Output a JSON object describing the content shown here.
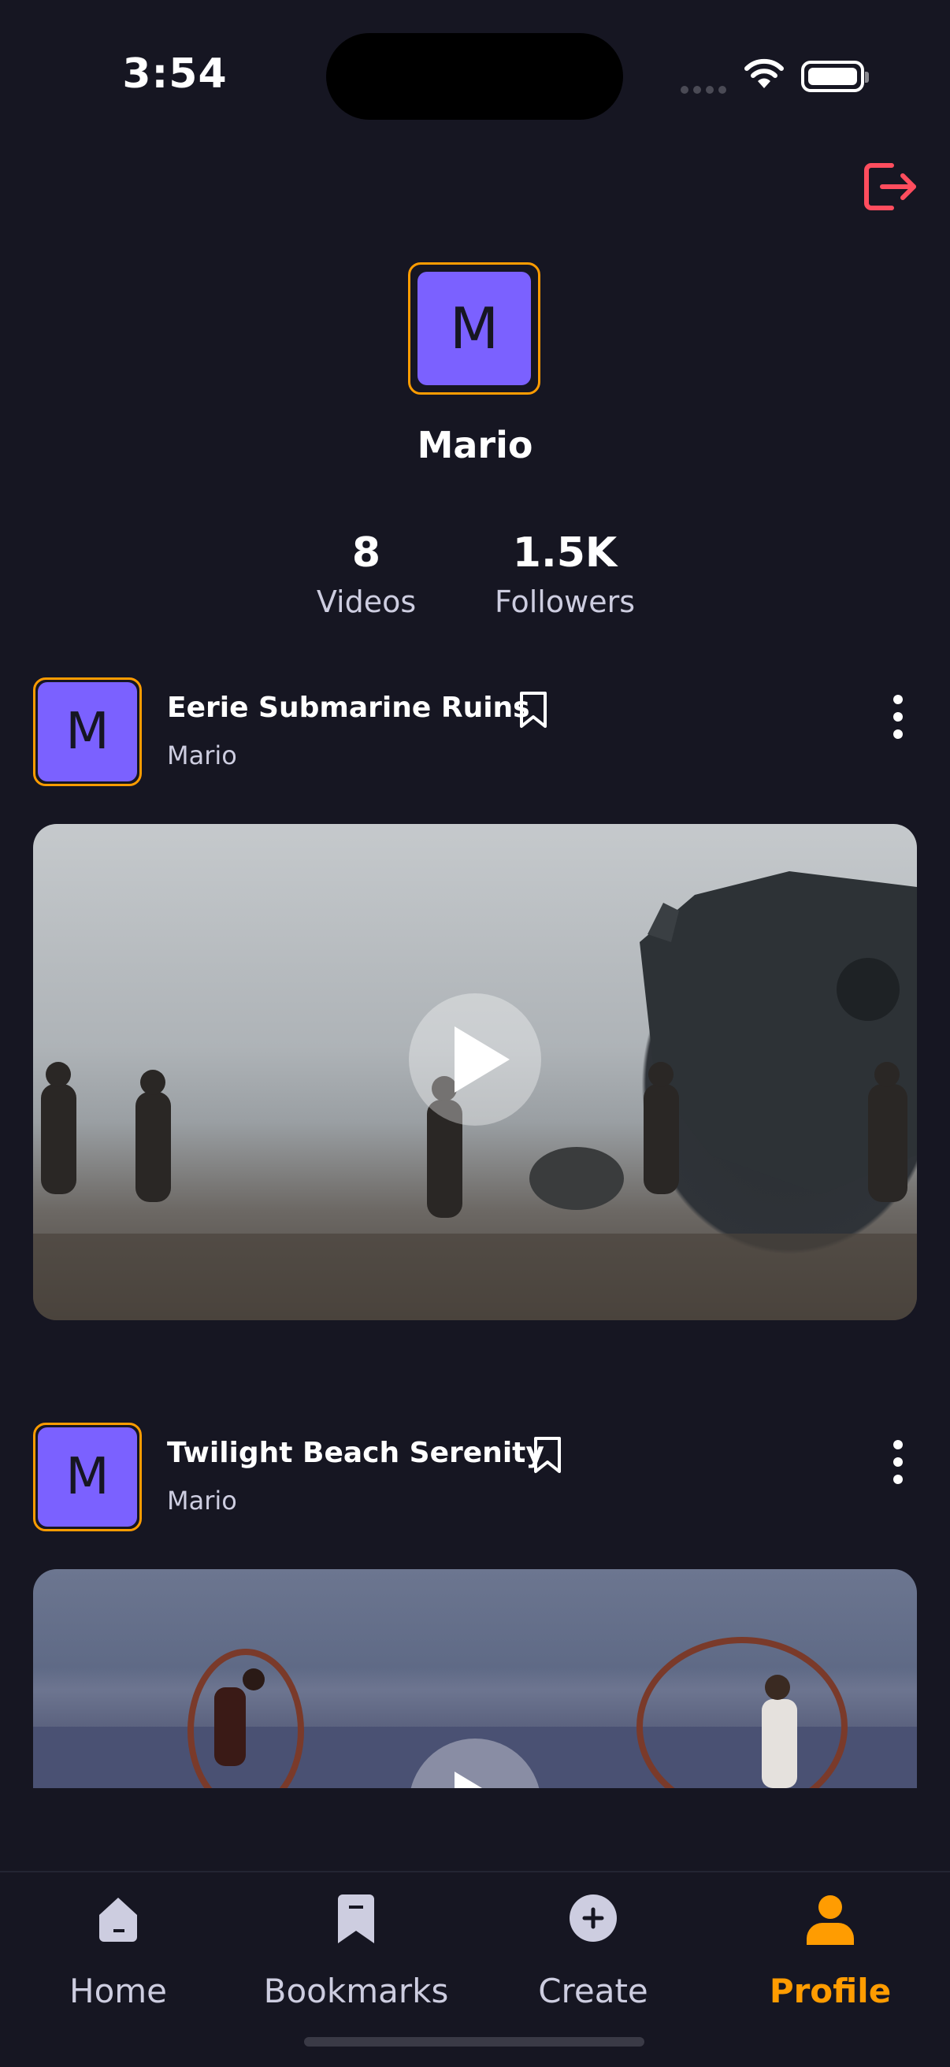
{
  "status_bar": {
    "time": "3:54"
  },
  "profile": {
    "avatar_letter": "M",
    "name": "Mario",
    "stats": [
      {
        "value": "8",
        "label": "Videos"
      },
      {
        "value": "1.5K",
        "label": "Followers"
      }
    ]
  },
  "posts": [
    {
      "avatar_letter": "M",
      "title": "Eerie Submarine Ruins",
      "author": "Mario"
    },
    {
      "avatar_letter": "M",
      "title": "Twilight Beach Serenity",
      "author": "Mario"
    }
  ],
  "tabs": [
    {
      "label": "Home",
      "icon": "home-icon",
      "active": false
    },
    {
      "label": "Bookmarks",
      "icon": "bookmark-icon",
      "active": false
    },
    {
      "label": "Create",
      "icon": "plus-icon",
      "active": false
    },
    {
      "label": "Profile",
      "icon": "profile-icon",
      "active": true
    }
  ],
  "colors": {
    "background": "#161622",
    "accent": "#FF9C01",
    "avatar": "#7b61ff",
    "logout": "#FF4D5E",
    "muted_text": "#CDCDE0"
  }
}
